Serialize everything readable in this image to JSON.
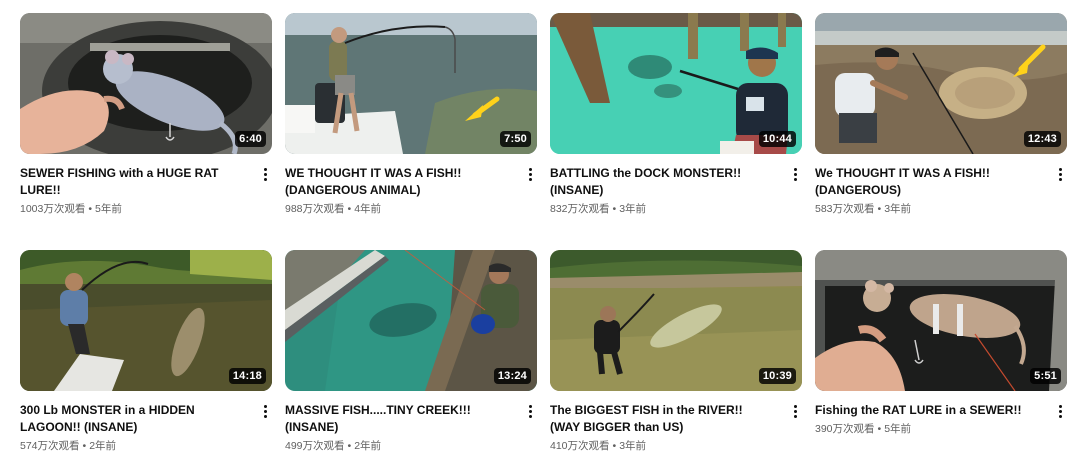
{
  "videos": [
    {
      "title": "SEWER FISHING with a HUGE RAT LURE!!",
      "views": "1003万次观看",
      "age": "5年前",
      "duration": "6:40"
    },
    {
      "title": "WE THOUGHT IT WAS A FISH!! (DANGEROUS ANIMAL)",
      "views": "988万次观看",
      "age": "4年前",
      "duration": "7:50"
    },
    {
      "title": "BATTLING the DOCK MONSTER!! (INSANE)",
      "views": "832万次观看",
      "age": "3年前",
      "duration": "10:44"
    },
    {
      "title": "We THOUGHT IT WAS A FISH!! (DANGEROUS)",
      "views": "583万次观看",
      "age": "3年前",
      "duration": "12:43"
    },
    {
      "title": "300 Lb MONSTER in a HIDDEN LAGOON!! (INSANE)",
      "views": "574万次观看",
      "age": "2年前",
      "duration": "14:18"
    },
    {
      "title": "MASSIVE FISH.....TINY CREEK!!! (INSANE)",
      "views": "499万次观看",
      "age": "2年前",
      "duration": "13:24"
    },
    {
      "title": "The BIGGEST FISH in the RIVER!! (WAY BIGGER than US)",
      "views": "410万次观看",
      "age": "3年前",
      "duration": "10:39"
    },
    {
      "title": "Fishing the RAT LURE in a SEWER!!",
      "views": "390万次观看",
      "age": "5年前",
      "duration": "5:51"
    }
  ],
  "separator": "•",
  "colors": {
    "title": "#0f0f0f",
    "secondary": "#606060",
    "duration_bg": "#000000"
  },
  "icons": {
    "more": "more-vert-icon"
  }
}
